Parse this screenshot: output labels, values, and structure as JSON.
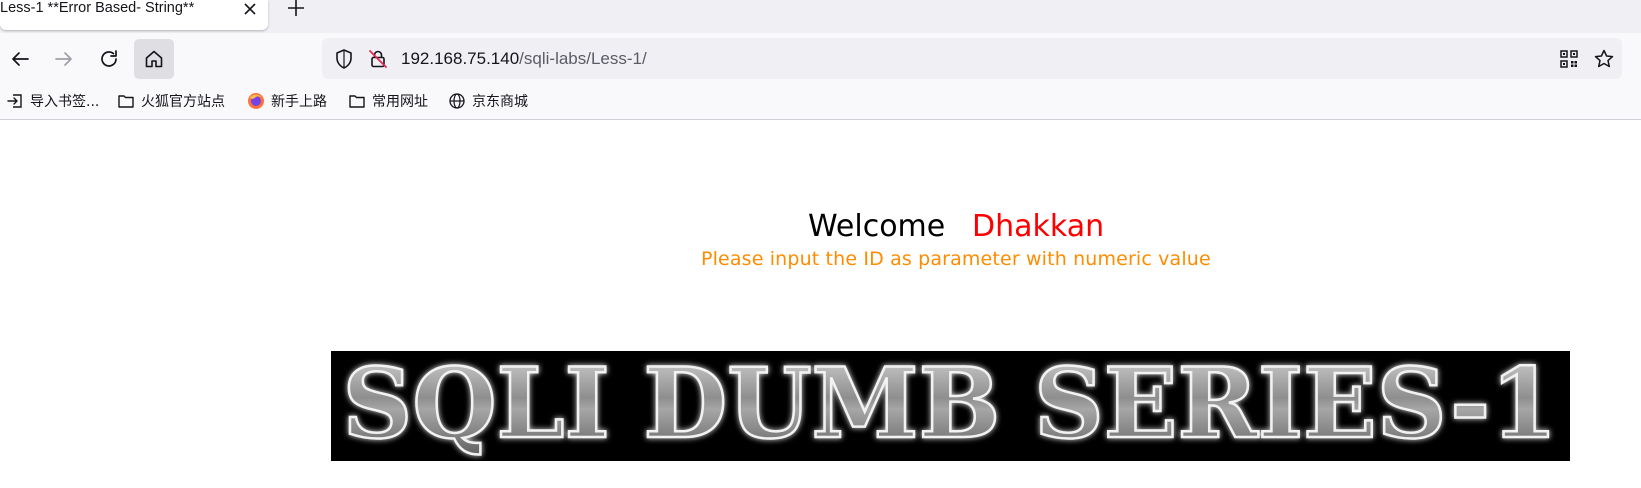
{
  "browser": {
    "tab": {
      "title": "Less-1 **Error Based- String**"
    },
    "url": {
      "host": "192.168.75.140",
      "path": "/sqli-labs/Less-1/"
    }
  },
  "bookmarks": [
    {
      "label": "导入书签...",
      "icon": "import-icon"
    },
    {
      "label": "火狐官方站点",
      "icon": "folder-icon"
    },
    {
      "label": "新手上路",
      "icon": "firefox-icon"
    },
    {
      "label": "常用网址",
      "icon": "folder-icon"
    },
    {
      "label": "京东商城",
      "icon": "globe-icon"
    }
  ],
  "page": {
    "welcome_label": "Welcome",
    "user_name": "Dhakkan",
    "hint": "Please input the ID as parameter with numeric value",
    "banner_text": "SQLI DUMB SERIES-1"
  },
  "colors": {
    "welcome": "#000000",
    "user_name": "#ff0000",
    "hint": "#ff8c00",
    "banner_bg": "#000000"
  }
}
